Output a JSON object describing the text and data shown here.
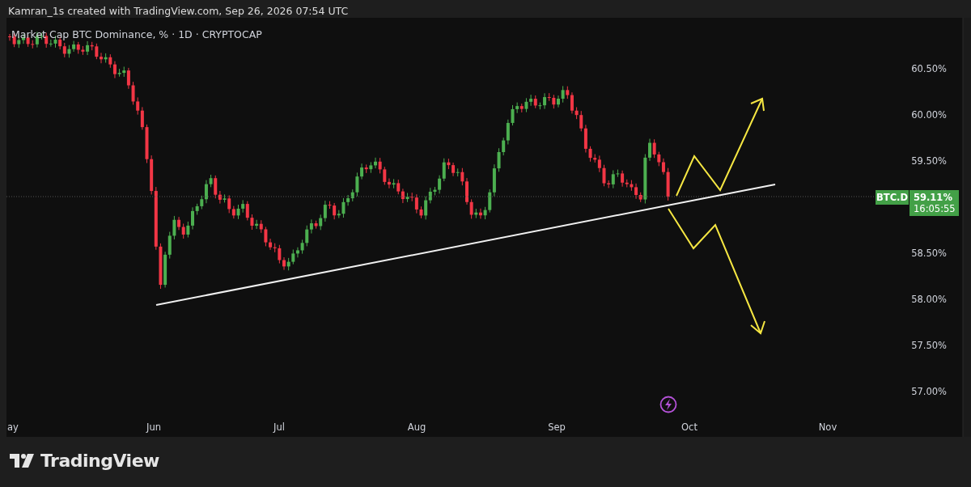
{
  "header": {
    "text": "Kamran_1s created with TradingView.com, Sep 26, 2026 07:54 UTC"
  },
  "legend": {
    "text": "Market Cap BTC Dominance, % · 1D · CRYPTOCAP"
  },
  "price_axis": {
    "ticks": [
      "60.50%",
      "60.00%",
      "59.50%",
      "58.50%",
      "58.00%",
      "57.50%",
      "57.00%"
    ]
  },
  "last_price": {
    "symbol": "BTC.D",
    "price": "59.11%",
    "countdown": "16:05:55"
  },
  "time_axis": {
    "labels": [
      "ay",
      "Jun",
      "Jul",
      "Aug",
      "Sep",
      "Oct",
      "Nov"
    ]
  },
  "brand": {
    "name": "TradingView"
  }
}
